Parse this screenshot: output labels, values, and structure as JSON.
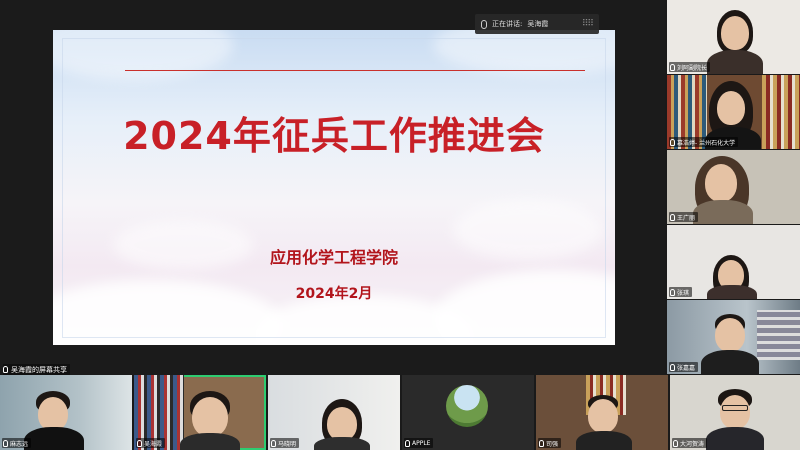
{
  "speaking": {
    "label": "正在讲话:",
    "name": "吴海霞"
  },
  "slide": {
    "title": "2024年征兵工作推进会",
    "subtitle": "应用化学工程学院",
    "date": "2024年2月"
  },
  "share_label": "吴海霞的屏幕共享",
  "right_participants": [
    {
      "name": "刘阿副院长"
    },
    {
      "name": "慕浩婷- 兰州石化大学"
    },
    {
      "name": "王广丽"
    },
    {
      "name": "张琪"
    },
    {
      "name": "张嘉嘉"
    }
  ],
  "bottom_participants": [
    {
      "name": "麻志远"
    },
    {
      "name": "吴海霞"
    },
    {
      "name": "马晓明"
    },
    {
      "name": "APPLE"
    },
    {
      "name": "司强"
    },
    {
      "name": "大河贺涛"
    }
  ],
  "colors": {
    "title_red": "#c82027",
    "active_speaker": "#2ecc71"
  }
}
